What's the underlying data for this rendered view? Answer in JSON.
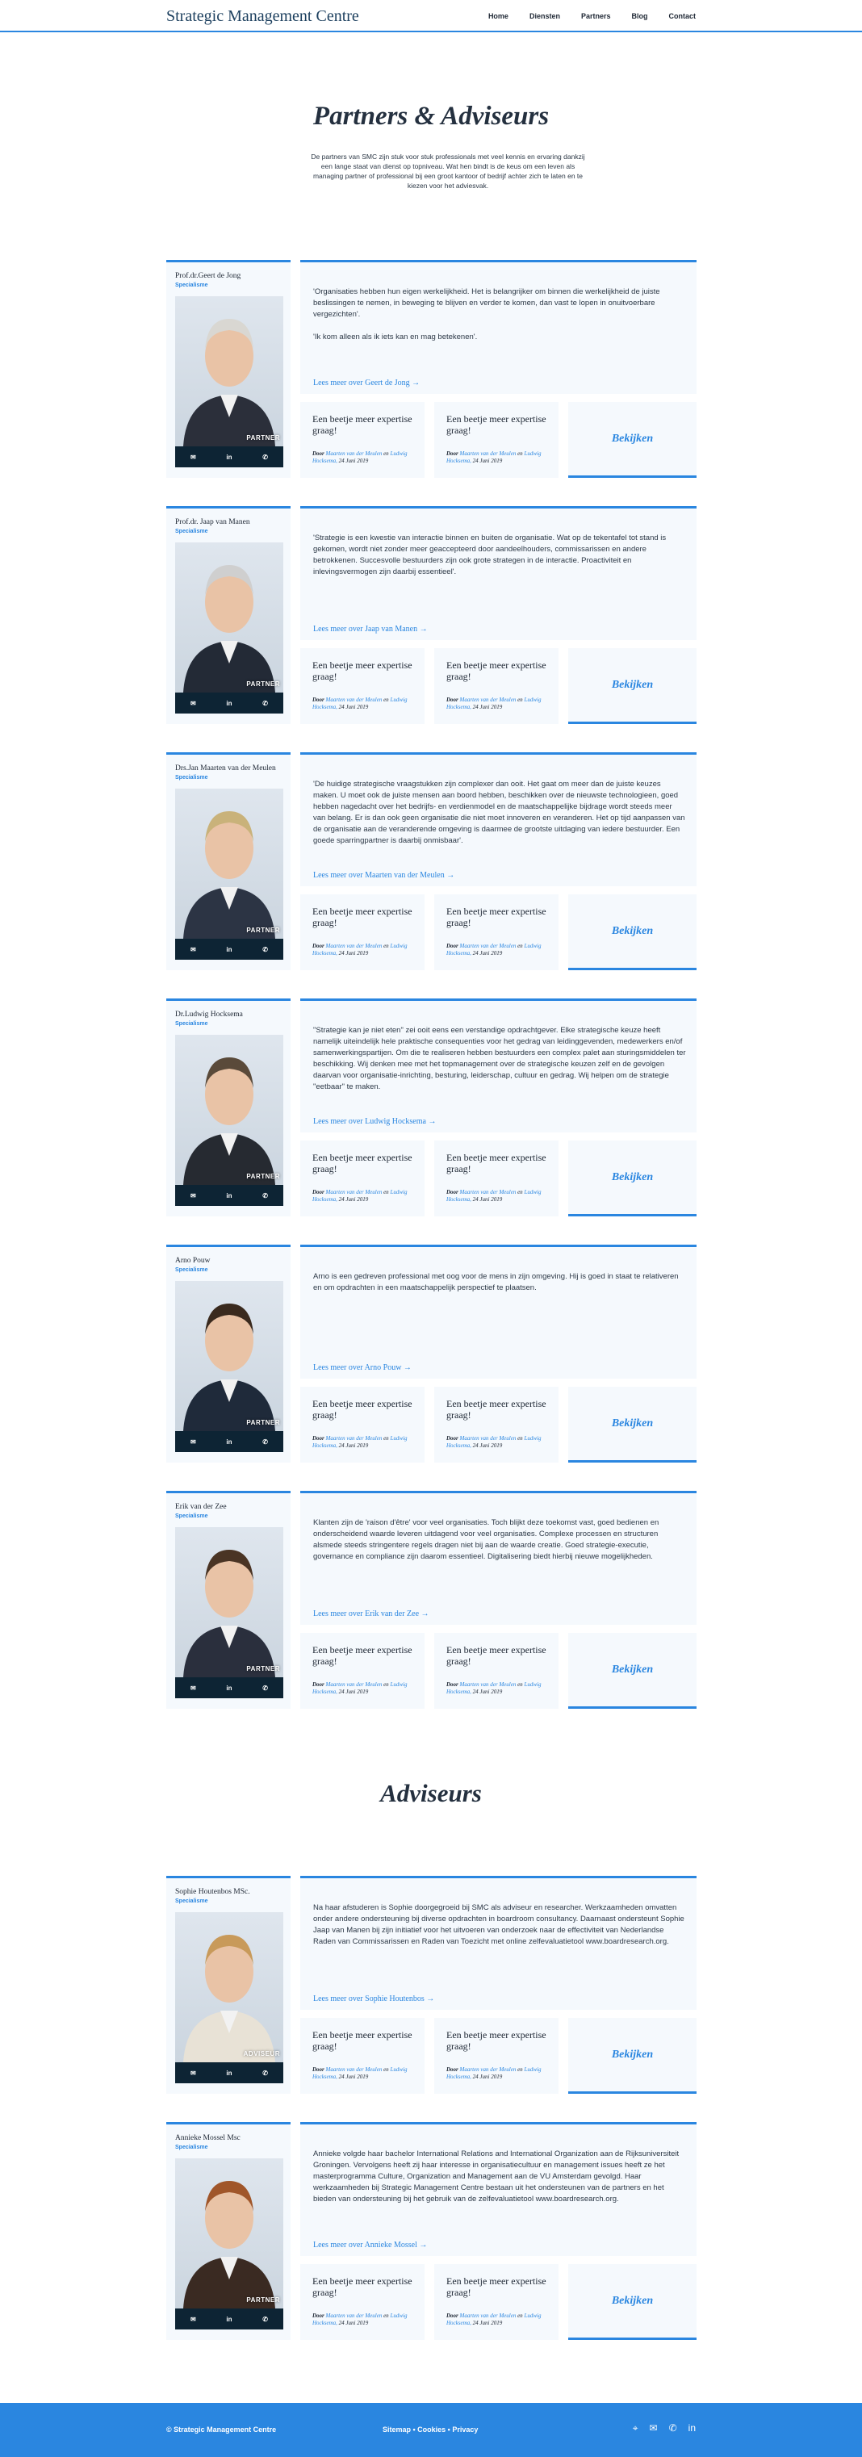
{
  "header": {
    "brand": "Strategic Management Centre",
    "nav": [
      "Home",
      "Diensten",
      "Partners",
      "Blog",
      "Contact"
    ]
  },
  "hero": {
    "title": "Partners & Adviseurs",
    "intro": "De partners van SMC zijn stuk voor stuk professionals met veel kennis en ervaring dankzij een lange staat van dienst op topniveau. Wat hen bindt is de keus om een leven als managing partner of professional bij een groot kantoor of bedrijf achter zich te laten en te kiezen voor het adviesvak."
  },
  "blog_teaser": {
    "title": "Een beetje meer expertise graag!",
    "by": "Door",
    "author1": "Maarten van der Meulen",
    "and": "en",
    "author2": "Ludwig Hocksema,",
    "date": "24 Juni 2019",
    "view_label": "Bekijken"
  },
  "social_icons": [
    "mail-icon",
    "linkedin-icon",
    "phone-icon"
  ],
  "people": [
    {
      "name": "Prof.dr.Geert de Jong",
      "specialism": "Specialisme",
      "role": "PARTNER",
      "quote": "'Organisaties hebben hun eigen werkelijkheid. Het is belangrijker om binnen die werkelijkheid de juiste beslissingen te nemen, in beweging te blijven en verder te komen, dan vast te lopen in onuitvoerbare vergezichten'.\n\n'Ik kom alleen als ik iets kan en mag betekenen'.",
      "more": "Lees meer over Geert de Jong →"
    },
    {
      "name": "Prof.dr. Jaap van Manen",
      "specialism": "Specialisme",
      "role": "PARTNER",
      "quote": "'Strategie is een kwestie van interactie binnen en buiten de organisatie. Wat op de tekentafel tot stand is gekomen, wordt niet zonder meer geaccepteerd door aandeelhouders, commissarissen en andere betrokkenen. Succesvolle bestuurders zijn ook grote strategen in de interactie. Proactiviteit en inlevingsvermogen zijn daarbij essentieel'.",
      "more": "Lees meer over Jaap van Manen →"
    },
    {
      "name": "Drs.Jan Maarten van der Meulen",
      "specialism": "Specialisme",
      "role": "PARTNER",
      "quote": "'De huidige strategische vraagstukken zijn complexer dan ooit. Het gaat om meer dan de juiste keuzes maken. U moet ook de juiste mensen aan boord hebben, beschikken over de nieuwste technologieen, goed hebben nagedacht over het bedrijfs- en verdienmodel en de maatschappelijke bijdrage wordt steeds meer van belang. Er is dan ook geen organisatie die niet moet innoveren en veranderen. Het op tijd aanpassen van de organisatie aan de veranderende omgeving is daarmee de grootste uitdaging van iedere bestuurder. Een goede sparringpartner is daarbij onmisbaar'.",
      "more": "Lees meer over Maarten van der Meulen →"
    },
    {
      "name": "Dr.Ludwig Hocksema",
      "specialism": "Specialisme",
      "role": "PARTNER",
      "quote": "\"Strategie kan je niet eten\" zei ooit eens een verstandige opdrachtgever. Elke strategische keuze heeft namelijk uiteindelijk hele praktische consequenties voor het gedrag van leidinggevenden, medewerkers en/of samenwerkingspartijen. Om die te realiseren hebben bestuurders een complex palet aan sturingsmiddelen ter beschikking. Wij denken mee met het topmanagement over de strategische keuzen zelf en de gevolgen daarvan voor organisatie-inrichting, besturing, leiderschap, cultuur en gedrag. Wij helpen om de strategie \"eetbaar\" te maken.",
      "more": "Lees meer over Ludwig Hocksema →"
    },
    {
      "name": "Arno Pouw",
      "specialism": "Specialisme",
      "role": "PARTNER",
      "quote": "Arno is een gedreven professional met oog voor de mens in zijn omgeving. Hij is goed in staat te relativeren en om opdrachten in een maatschappelijk perspectief te plaatsen.",
      "more": "Lees meer over Arno Pouw →"
    },
    {
      "name": "Erik van der Zee",
      "specialism": "Specialisme",
      "role": "PARTNER",
      "quote": "Klanten zijn de 'raison d'être' voor veel organisaties. Toch blijkt deze toekomst vast, goed bedienen en onderscheidend waarde leveren uitdagend voor veel organisaties. Complexe processen en structuren alsmede steeds stringentere regels dragen niet bij aan de waarde creatie. Goed strategie-executie, governance en compliance zijn daarom essentieel. Digitalisering biedt hierbij nieuwe mogelijkheden.",
      "more": "Lees meer over Erik van der Zee →"
    }
  ],
  "advisors_title": "Adviseurs",
  "advisors": [
    {
      "name": "Sophie Houtenbos MSc.",
      "specialism": "Specialisme",
      "role": "ADVISEUR",
      "quote": "Na haar afstuderen is Sophie doorgegroeid bij SMC als adviseur en researcher. Werkzaamheden omvatten onder andere ondersteuning bij diverse opdrachten in boardroom consultancy. Daarnaast ondersteunt Sophie Jaap van Manen bij zijn initiatief voor het uitvoeren van onderzoek naar de effectiviteit van Nederlandse Raden van Commissarissen en Raden van Toezicht met online zelfevaluatietool www.boardresearch.org.",
      "more": "Lees meer over Sophie Houtenbos →"
    },
    {
      "name": "Annieke Mossel Msc",
      "specialism": "Specialisme",
      "role": "PARTNER",
      "quote": "Annieke volgde haar bachelor International Relations and International Organization aan de Rijksuniversiteit Groningen. Vervolgens heeft zij haar interesse in organisatiecultuur en management issues heeft ze het masterprogramma Culture, Organization and Management aan de VU Amsterdam gevolgd. Haar werkzaamheden bij Strategic Management Centre bestaan uit het ondersteunen van de partners en het bieden van ondersteuning bij het gebruik van de zelfevaluatietool www.boardresearch.org.",
      "more": "Lees meer over Annieke Mossel →"
    }
  ],
  "footer": {
    "copy": "© Strategic Management Centre",
    "links": "Sitemap • Cookies • Privacy",
    "icons": [
      "location-icon",
      "mail-icon",
      "phone-icon",
      "linkedin-icon"
    ]
  }
}
